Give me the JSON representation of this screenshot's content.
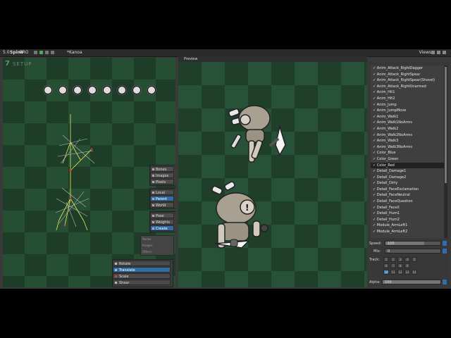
{
  "titlebar": {
    "version": "5.0",
    "logo": "Spine",
    "edition": "PRO",
    "file": "*Kanoa",
    "views": "Views"
  },
  "setup": {
    "label": "SETUP",
    "number": "7",
    "object_panel": [
      "Bones",
      "Images",
      "Pixels"
    ],
    "axes_panel": [
      {
        "label": "Local",
        "selected": false
      },
      {
        "label": "Parent",
        "selected": true
      },
      {
        "label": "World",
        "selected": false
      }
    ],
    "options_panel": [
      {
        "label": "Pose",
        "selected": false
      },
      {
        "label": "Weights",
        "selected": false
      },
      {
        "label": "Create",
        "selected": true
      }
    ],
    "counters": [
      "Bones",
      "Images",
      "Others"
    ],
    "transform_tools": [
      {
        "label": "Rotate",
        "selected": false
      },
      {
        "label": "Translate",
        "selected": true
      },
      {
        "label": "Scale",
        "selected": false
      },
      {
        "label": "Shear",
        "selected": false
      }
    ]
  },
  "preview": {
    "title": "Preview"
  },
  "animations": [
    "Anim_Attack_RightDagger",
    "Anim_Attack_RightSpear",
    "Anim_Attack_RightSpear(Shovel)",
    "Anim_Attack_RightUnarmed",
    "Anim_Hit1",
    "Anim_Hit2",
    "Anim_Jump",
    "Anim_JumpMove",
    "Anim_Walk1",
    "Anim_Walk1NoArms",
    "Anim_Walk2",
    "Anim_Walk2NoArms",
    "Anim_Walk3",
    "Anim_Walk3NoArms",
    "Color_Blue",
    "Color_Green",
    "Color_Red",
    "Detail_Damage1",
    "Detail_Damage2",
    "Detail_Dirty",
    "Detail_FaceExclamation",
    "Detail_FaceNeutral",
    "Detail_FaceQuestion",
    "Detail_FaceX",
    "Detail_Hum1",
    "Detail_Hum2",
    "Module_ArmLeft1",
    "Module_ArmLeft2"
  ],
  "selected_animation": "Color_Red",
  "controls": {
    "speed_label": "Speed:",
    "speed_value": "100",
    "speed_fraction": 0.7,
    "mix_label": "Mix:",
    "mix_value": "0",
    "mix_fraction": 0.0,
    "track_label": "Track:",
    "track_rows": [
      [
        "1",
        "2",
        "3",
        "4",
        "5"
      ],
      [
        "6",
        "7",
        "8",
        "9"
      ],
      [
        "10",
        "11",
        "12",
        "13",
        "14"
      ]
    ],
    "selected_track": "10",
    "alpha_label": "Alpha:",
    "alpha_value": "100",
    "alpha_fraction": 1.0
  },
  "colors": {
    "accent": "#2f6ea8",
    "board_dark": "#1f3f2a",
    "board_light": "#28513a"
  }
}
